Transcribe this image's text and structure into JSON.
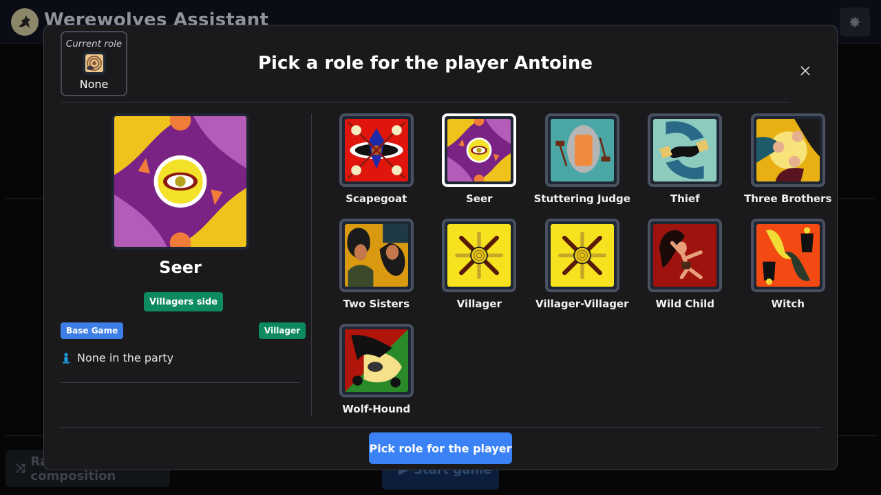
{
  "app": {
    "title": "Werewolves Assistant",
    "logo_icon": "wolf-howling-icon",
    "settings_icon": "gear-icon"
  },
  "background": {
    "random_composition_label": "Random composition",
    "random_icon": "shuffle-icon",
    "start_game_label": "Start game",
    "start_icon": "play-icon"
  },
  "modal": {
    "title": "Pick a role for the player Antoine",
    "close_icon": "close-icon",
    "current_role": {
      "label": "Current role",
      "name": "None",
      "icon": "spiral-role-icon"
    },
    "detail": {
      "name": "Seer",
      "side_badge": "Villagers side",
      "origin_badge": "Base Game",
      "type_badge": "Villager",
      "party_icon": "person-icon",
      "party_text": "None in the party"
    },
    "roles": [
      {
        "name": "Scapegoat",
        "art": "scapegoat",
        "selected": false
      },
      {
        "name": "Seer",
        "art": "seer",
        "selected": true
      },
      {
        "name": "Stuttering Judge",
        "art": "judge",
        "selected": false
      },
      {
        "name": "Thief",
        "art": "thief",
        "selected": false
      },
      {
        "name": "Three Brothers",
        "art": "brothers",
        "selected": false
      },
      {
        "name": "Two Sisters",
        "art": "sisters",
        "selected": false
      },
      {
        "name": "Villager",
        "art": "villager",
        "selected": false
      },
      {
        "name": "Villager-Villager",
        "art": "villager",
        "selected": false
      },
      {
        "name": "Wild Child",
        "art": "wildchild",
        "selected": false
      },
      {
        "name": "Witch",
        "art": "witch",
        "selected": false
      },
      {
        "name": "Wolf-Hound",
        "art": "wolfhound",
        "selected": false
      }
    ],
    "submit_label": "Pick role for the player"
  },
  "colors": {
    "primary": "#3b82f6",
    "villagers_green": "#0e8a5f",
    "modal_bg": "#1a1a1c",
    "page_bg": "#060606"
  }
}
